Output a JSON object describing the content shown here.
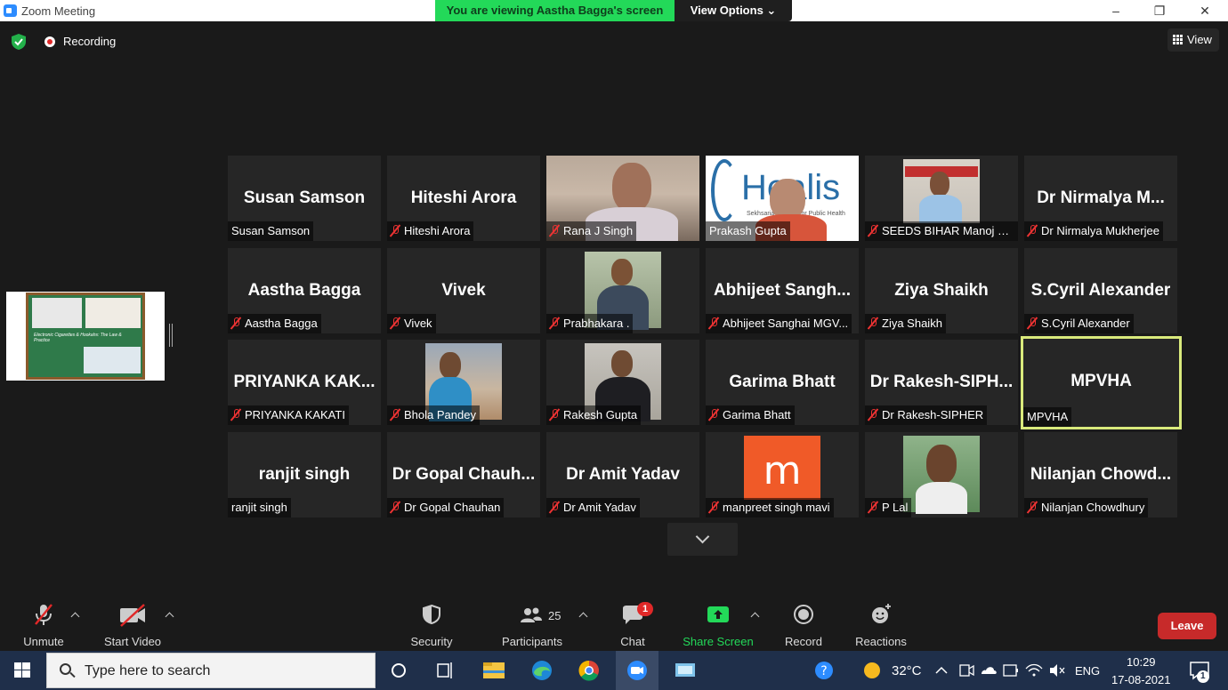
{
  "window": {
    "title": "Zoom Meeting",
    "minimize": "–",
    "restore": "❐",
    "close": "✕"
  },
  "banner": {
    "viewing": "You are viewing Aastha Bagga's screen",
    "view_options": "View Options ⌄"
  },
  "topbar": {
    "recording": "Recording",
    "view": "View"
  },
  "shared_screen": {
    "caption": "Electronic Cigarettes & Hookahs: The Law & Practice"
  },
  "tiles": [
    {
      "big": "Susan Samson",
      "label": "Susan Samson",
      "muted": false
    },
    {
      "big": "Hiteshi Arora",
      "label": "Hiteshi Arora",
      "muted": true
    },
    {
      "big": "",
      "label": "Rana J Singh",
      "muted": true,
      "video": "rana"
    },
    {
      "big": "",
      "label": "Prakash Gupta",
      "muted": false,
      "video": "prakash",
      "brand": "Healis",
      "sub": "Sekhsaria Institute for Public Health"
    },
    {
      "big": "",
      "label": "SEEDS BIHAR Manoj K...",
      "muted": true,
      "video": "seeds"
    },
    {
      "big": "Dr Nirmalya M...",
      "label": "Dr Nirmalya Mukherjee",
      "muted": true
    },
    {
      "big": "Aastha Bagga",
      "label": "Aastha Bagga",
      "muted": true
    },
    {
      "big": "Vivek",
      "label": "Vivek",
      "muted": true
    },
    {
      "big": "",
      "label": "Prabhakara .",
      "muted": true,
      "video": "prabha"
    },
    {
      "big": "Abhijeet Sangh...",
      "label": "Abhijeet Sanghai MGV...",
      "muted": true
    },
    {
      "big": "Ziya Shaikh",
      "label": "Ziya Shaikh",
      "muted": true
    },
    {
      "big": "S.Cyril Alexander",
      "label": "S.Cyril Alexander",
      "muted": true
    },
    {
      "big": "PRIYANKA KAK...",
      "label": "PRIYANKA KAKATI",
      "muted": true
    },
    {
      "big": "",
      "label": "Bhola Pandey",
      "muted": true,
      "video": "bhola"
    },
    {
      "big": "",
      "label": "Rakesh Gupta",
      "muted": true,
      "video": "rakesh"
    },
    {
      "big": "Garima Bhatt",
      "label": "Garima Bhatt",
      "muted": true
    },
    {
      "big": "Dr Rakesh-SIPH...",
      "label": "Dr Rakesh-SIPHER",
      "muted": true
    },
    {
      "big": "MPVHA",
      "label": "MPVHA",
      "muted": false,
      "active": true
    },
    {
      "big": "ranjit singh",
      "label": "ranjit singh",
      "muted": false
    },
    {
      "big": "Dr Gopal Chauh...",
      "label": "Dr Gopal Chauhan",
      "muted": true
    },
    {
      "big": "Dr Amit Yadav",
      "label": "Dr Amit Yadav",
      "muted": true
    },
    {
      "big": "",
      "label": "manpreet singh mavi",
      "muted": true,
      "video": "m",
      "letter": "m"
    },
    {
      "big": "",
      "label": "P Lal",
      "muted": true,
      "video": "plal"
    },
    {
      "big": "Nilanjan Chowd...",
      "label": "Nilanjan Chowdhury",
      "muted": true
    }
  ],
  "toolbar": {
    "unmute": "Unmute",
    "start_video": "Start Video",
    "security": "Security",
    "participants": "Participants",
    "participants_count": "25",
    "chat": "Chat",
    "chat_badge": "1",
    "share_screen": "Share Screen",
    "record": "Record",
    "reactions": "Reactions",
    "leave": "Leave"
  },
  "taskbar": {
    "search_placeholder": "Type here to search",
    "temperature": "32°C",
    "language": "ENG",
    "time": "10:29",
    "date": "17-08-2021",
    "notification_count": "1"
  },
  "colors": {
    "share_green": "#23d959",
    "leave_red": "#c72a2a",
    "active_border": "#d9ea7c",
    "tile_bg": "#262626"
  }
}
